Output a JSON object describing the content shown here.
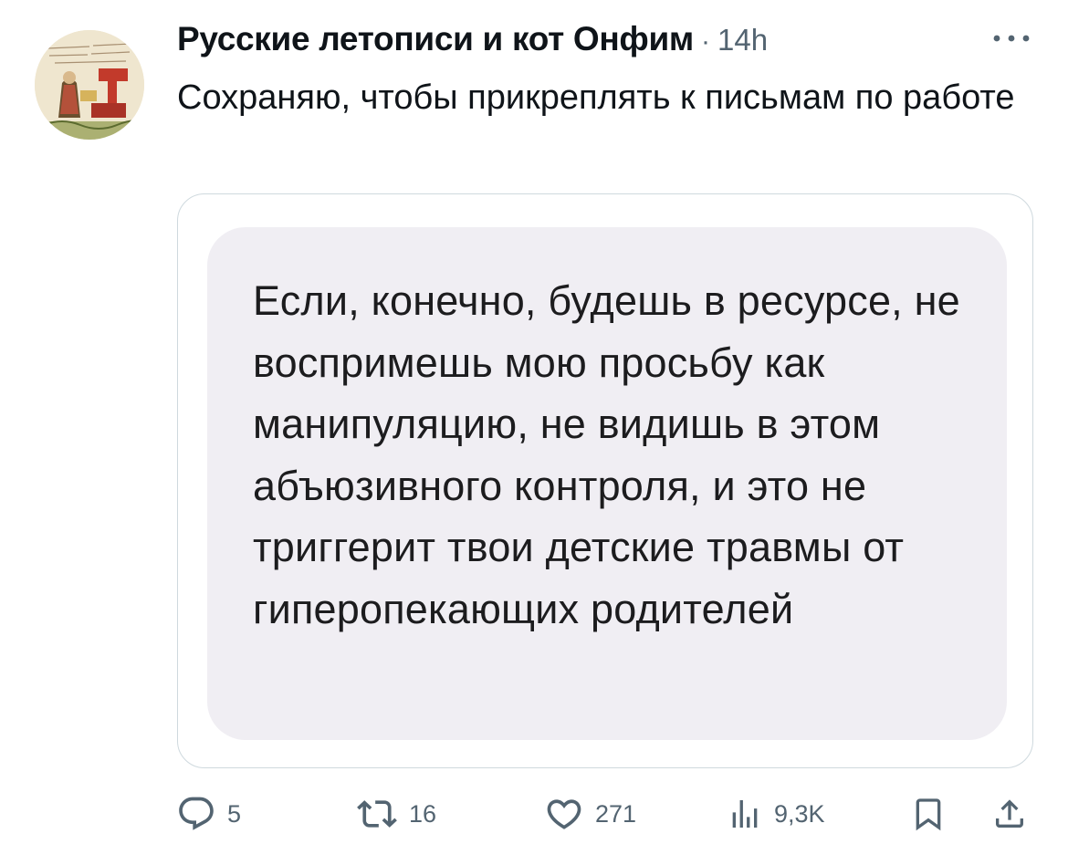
{
  "tweet": {
    "author": "Русские летописи и кот Онфим",
    "separator": "·",
    "time": "14h",
    "text": "Сохраняю, чтобы прикреплять к письмам по работе",
    "image_text": "Если, конечно, будешь в ресурсе, не воспримешь мою просьбу как манипуляцию, не видишь в этом абъюзивного контроля, и это не триггерит твои детские травмы от гиперопекающих родителей"
  },
  "actions": {
    "replies": "5",
    "reposts": "16",
    "likes": "271",
    "views": "9,3K"
  },
  "icons": {
    "more": "more-horizontal-icon",
    "reply": "reply-icon",
    "repost": "repost-icon",
    "like": "heart-icon",
    "views": "views-bar-chart-icon",
    "bookmark": "bookmark-icon",
    "share": "share-icon"
  },
  "colors": {
    "text": "#0f1419",
    "secondary": "#536471",
    "border": "#cfd9de",
    "bubble": "#f0eef3"
  }
}
